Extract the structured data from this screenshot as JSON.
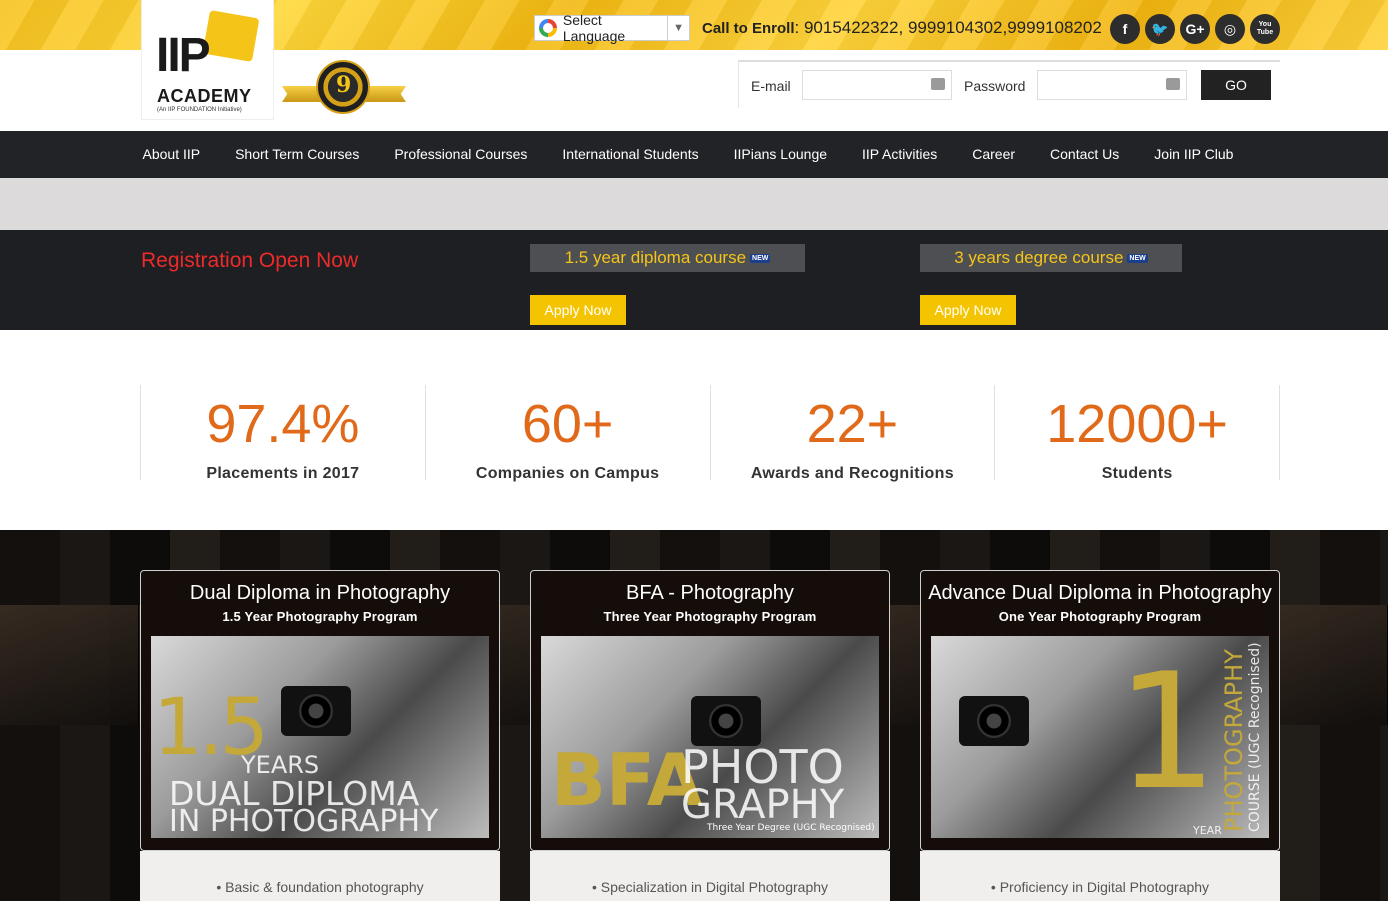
{
  "brand": {
    "logo_text": "IIP",
    "academy": "ACADEMY",
    "tagline": "(An IIP FOUNDATION Initiative)",
    "badge_number": "9",
    "accent": "#f5c419"
  },
  "topbar": {
    "language_label": "Select Language",
    "call_label": "Call to Enroll",
    "call_numbers": ": 9015422322, 9999104302,9999108202",
    "social": [
      "f",
      "t",
      "G+",
      "ig",
      "You Tube"
    ]
  },
  "login": {
    "email_label": "E-mail",
    "password_label": "Password",
    "go_label": "GO"
  },
  "nav": {
    "items": [
      "About IIP",
      "Short Term Courses",
      "Professional Courses",
      "International Students",
      "IIPians Lounge",
      "IIP Activities",
      "Career",
      "Contact Us",
      "Join IIP Club"
    ]
  },
  "registration": {
    "title": "Registration Open Now",
    "course1": "1.5 year diploma course",
    "course2": "3 years degree course",
    "new_tag": "NEW",
    "apply": "Apply Now"
  },
  "stats": [
    {
      "value": "97.4%",
      "label": "Placements in 2017"
    },
    {
      "value": "60+",
      "label": "Companies on Campus"
    },
    {
      "value": "22+",
      "label": "Awards and Recognitions"
    },
    {
      "value": "12000+",
      "label": "Students"
    }
  ],
  "programs": [
    {
      "title": "Dual Diploma in Photography",
      "subtitle": "1.5 Year Photography Program",
      "img_a": "1.5",
      "img_b": "YEARS",
      "img_c": "DUAL DIPLOMA",
      "img_d": "IN PHOTOGRAPHY",
      "bullet": "Basic & foundation photography"
    },
    {
      "title": "BFA - Photography",
      "subtitle": "Three Year Photography Program",
      "img_a": "BFA",
      "img_b": "PHOTO",
      "img_c": "GRAPHY",
      "img_d": "Three Year Degree (UGC Recognised)",
      "bullet": "Specialization in Digital Photography"
    },
    {
      "title": "Advance Dual Diploma in Photography",
      "subtitle": "One Year Photography Program",
      "img_a": "1",
      "img_b": "YEAR",
      "img_c": "PHOTOGRAPHY",
      "img_d": "COURSE (UGC Recognised)",
      "bullet": "Proficiency in Digital Photography"
    }
  ]
}
